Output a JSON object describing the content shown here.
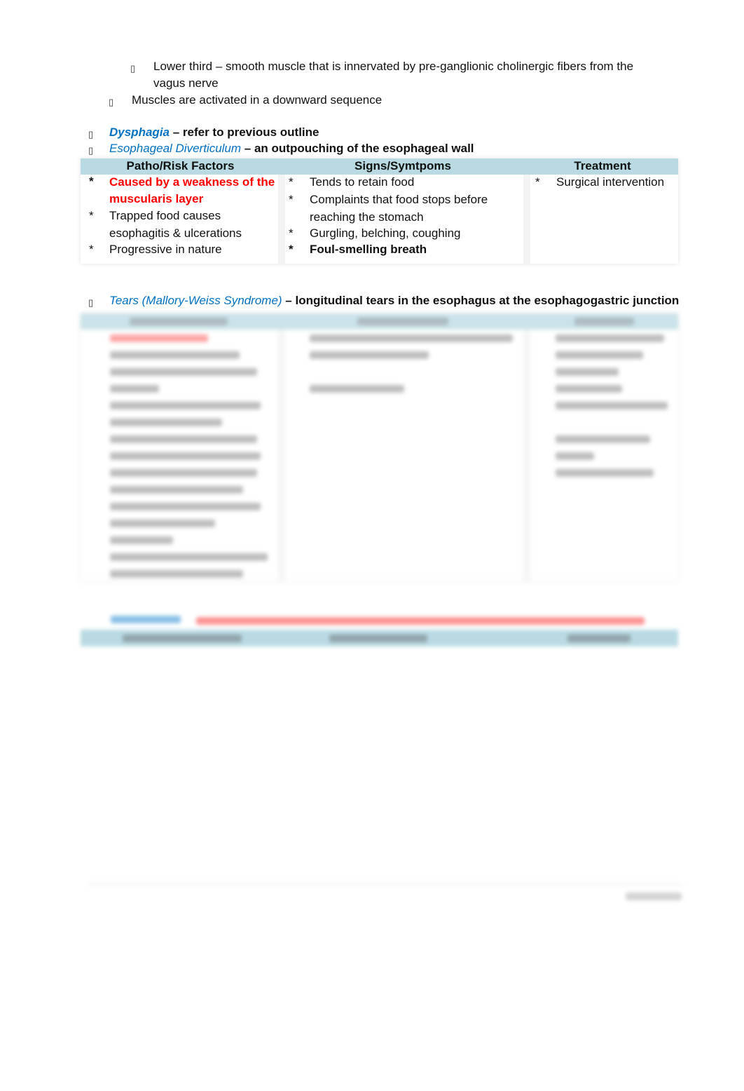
{
  "bullets": {
    "square": "▯"
  },
  "intro": {
    "lower_third": "Lower third – smooth muscle that is innervated by pre-ganglionic cholinergic fibers from the",
    "lower_third_cont": "vagus nerve",
    "activation": "Muscles are activated in a downward sequence"
  },
  "dysphagia": {
    "term": "Dysphagia",
    "desc": "– refer to previous outline"
  },
  "diverticulum": {
    "term": "Esophageal Diverticulum",
    "desc": "– an outpouching of the esophageal wall",
    "table": {
      "headers": [
        "Patho/Risk Factors",
        "Signs/Symtpoms",
        "Treatment"
      ],
      "patho": [
        "Caused by a weakness of the",
        "muscularis layer",
        "Trapped food causes",
        "esophagitis & ulcerations",
        "Progressive in nature"
      ],
      "signs": [
        "Tends to retain food",
        "Complaints that food stops before",
        "reaching the stomach",
        "Gurgling, belching, coughing",
        "Foul-smelling breath"
      ],
      "treatment": [
        "Surgical intervention"
      ],
      "star": "*"
    }
  },
  "tears": {
    "term": "Tears (Mallory-Weiss Syndrome)",
    "desc": "– longitudinal tears in the esophagus at the esophagogastric junction"
  },
  "colors": {
    "link_blue": "#0070c0",
    "highlight_red": "#ff0000",
    "table_header": "#b9dae3"
  }
}
